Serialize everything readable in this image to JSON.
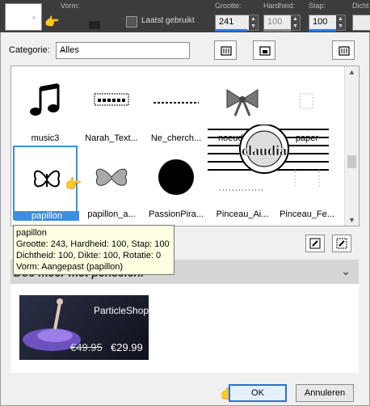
{
  "toolbar": {
    "vorm_label": "Vorm:",
    "recent_label": "Laatst gebruikt",
    "size_label": "Grootte:",
    "size_value": "241",
    "hardness_label": "Hardheid:",
    "hardness_value": "100",
    "step_label": "Stap:",
    "step_value": "100",
    "density_label": "Dicht"
  },
  "category": {
    "label": "Categorie:",
    "value": "Alles"
  },
  "gallery": {
    "items": [
      {
        "label": "music3"
      },
      {
        "label": "Narah_Text..."
      },
      {
        "label": "Ne_cherch..."
      },
      {
        "label": "noeud_lint..."
      },
      {
        "label": "paper"
      },
      {
        "label": "papillon"
      },
      {
        "label": "papillon_a..."
      },
      {
        "label": "PassionPira..."
      },
      {
        "label": "Pinceau_Ai..."
      },
      {
        "label": "Pinceau_Fe..."
      }
    ],
    "overlay_text": "claudia"
  },
  "tooltip": {
    "line1": "papillon",
    "line2": "Grootte: 243, Hardheid: 100, Stap: 100",
    "line3": "Dichtheid: 100, Dikte: 100, Rotatie: 0",
    "line4": "Vorm: Aangepast (papillon)"
  },
  "more": {
    "title": "Doe meer met penselen.",
    "product": "ParticleShop",
    "old_price": "€49.95",
    "new_price": "€29.99"
  },
  "buttons": {
    "ok": "OK",
    "cancel": "Annuleren"
  },
  "colors": {
    "accent": "#3c8fe0",
    "toolbar": "#3c3c3c"
  }
}
